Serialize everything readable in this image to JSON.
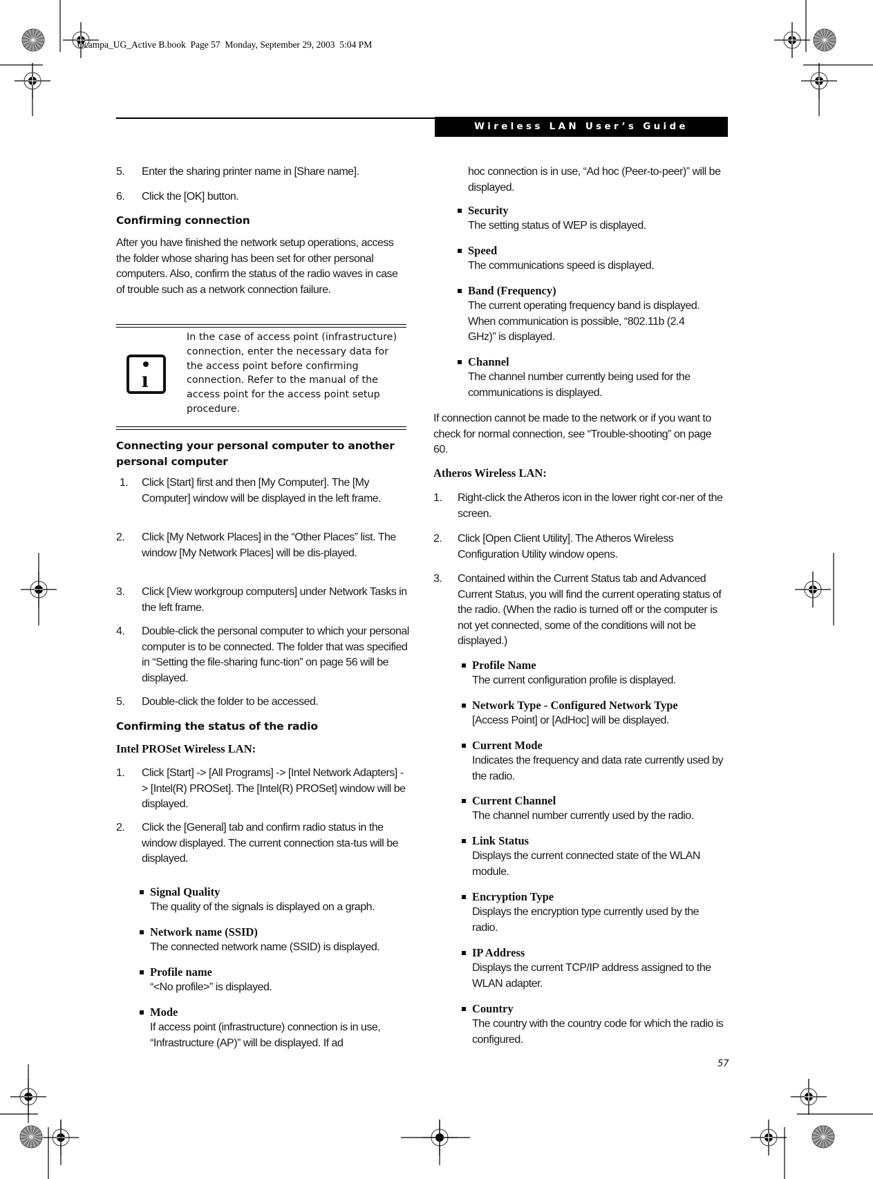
{
  "print_header": {
    "slug": "Ocampa_UG_Active B.book  Page 57  Monday, September 29, 2003  5:04 PM"
  },
  "running_header": {
    "title": "Wireless LAN User’s Guide"
  },
  "left_column": {
    "steps_a": [
      {
        "num": "5.",
        "text": "Enter the sharing printer name in [Share name]."
      },
      {
        "num": "6.",
        "text": "Click the [OK] button."
      }
    ],
    "confirming_connection": {
      "heading": "Confirming connection",
      "paragraph": "After you have finished the network setup operations, access the folder whose sharing has been set for other personal computers. Also, confirm the status of the radio waves in case of trouble such as a network connection failure."
    },
    "note": {
      "icon": "info-icon",
      "text": "In the case of access point (infrastructure) connection, enter the necessary data for the access point before confirming connection. Refer to the manual of the access point for the access point setup procedure."
    },
    "connecting_pc": {
      "heading": "Connecting your personal computer to another personal computer",
      "steps": [
        {
          "num": "1.",
          "text": "Click [Start] first and then [My Computer]. The [My Computer] window will be displayed in the left frame."
        },
        {
          "num": "2.",
          "text": "Click [My Network Places] in the “Other Places” list. The window [My Network Places] will be dis-played."
        },
        {
          "num": "3.",
          "text": "Click [View workgroup computers] under Network Tasks in the left frame."
        },
        {
          "num": "4.",
          "text": "Double-click the personal computer to which your personal computer is to be connected. The folder that was specified in “Setting the file-sharing func-tion” on page 56 will be displayed."
        },
        {
          "num": "5.",
          "text": "Double-click the folder to be accessed."
        }
      ]
    },
    "radio_status": {
      "heading": "Confirming the status of the radio",
      "subheading": "Intel PROSet Wireless LAN:",
      "steps": [
        {
          "num": "1.",
          "text": "Click [Start] -> [All Programs] -> [Intel Network Adapters] -> [Intel(R) PROSet]. The [Intel(R) PROSet] window will be displayed."
        },
        {
          "num": "2.",
          "text": "Click the [General] tab and confirm radio status in the window displayed. The current connection sta-tus will be displayed."
        }
      ],
      "bullets": [
        {
          "term": "Signal Quality",
          "desc": "The quality of the signals is displayed on a graph."
        },
        {
          "term": "Network name (SSID)",
          "desc": "The connected network name (SSID) is displayed."
        },
        {
          "term": "Profile name",
          "desc": "“<No profile>” is displayed."
        },
        {
          "term": "Mode",
          "desc": "If access point (infrastructure) connection is in use, “Infrastructure (AP)” will be displayed. If ad"
        }
      ]
    }
  },
  "right_column": {
    "mode_continued": "hoc connection is in use, “Ad hoc (Peer-to-peer)” will be displayed.",
    "bullets": [
      {
        "term": "Security",
        "desc": "The setting status of WEP is displayed."
      },
      {
        "term": "Speed",
        "desc": "The communications speed is displayed."
      },
      {
        "term": "Band (Frequency)",
        "desc": "The current operating frequency band is displayed. When communication is possible, “802.11b (2.4 GHz)” is displayed."
      },
      {
        "term": "Channel",
        "desc": "The channel number currently being used for the communications is displayed."
      }
    ],
    "troubleshoot_paragraph": "If connection cannot be made to the network or if you want to check for normal connection, see “Trouble-shooting” on page 60.",
    "atheros": {
      "subheading": "Atheros Wireless LAN:",
      "steps": [
        {
          "num": "1.",
          "text": "Right-click the Atheros icon in the lower right cor-ner of the screen."
        },
        {
          "num": "2.",
          "text": "Click [Open Client Utility]. The Atheros Wireless Configuration Utility window opens."
        },
        {
          "num": "3.",
          "text": "Contained within the Current Status tab and Advanced Current Status, you will find the current operating status of the radio. (When the radio is turned off or the computer is not yet connected, some of the conditions will not be displayed.)"
        }
      ],
      "bullets": [
        {
          "term": "Profile Name",
          "desc": "The current configuration profile is displayed."
        },
        {
          "term": "Network Type - Configured Network Type",
          "desc": "[Access Point] or [AdHoc] will be displayed."
        },
        {
          "term": "Current Mode",
          "desc": "Indicates the frequency and data rate currently used by the radio."
        },
        {
          "term": "Current Channel",
          "desc": "The channel number currently used by the radio."
        },
        {
          "term": "Link Status",
          "desc": "Displays the current connected state of the WLAN module."
        },
        {
          "term": "Encryption Type",
          "desc": "Displays the encryption type currently used by the radio."
        },
        {
          "term": "IP Address",
          "desc": "Displays the current TCP/IP address assigned to the WLAN adapter."
        },
        {
          "term": "Country",
          "desc": "The country with the country code for which the radio is configured."
        }
      ]
    }
  },
  "footer": {
    "page_number": "57"
  }
}
